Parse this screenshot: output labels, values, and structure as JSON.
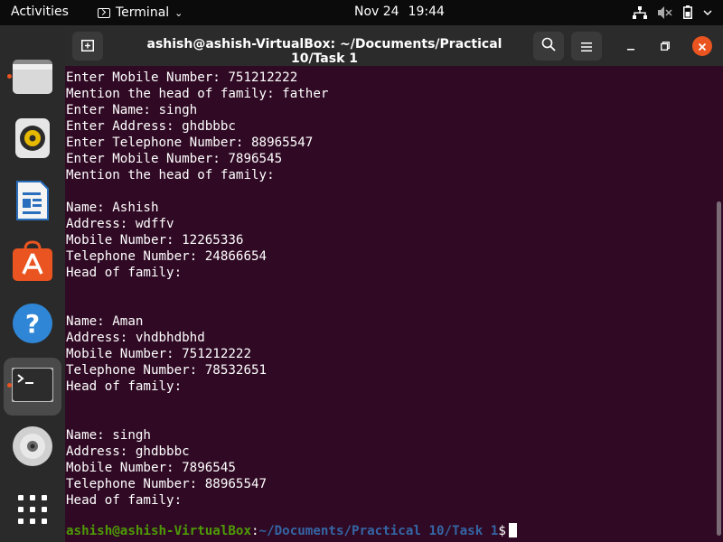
{
  "topbar": {
    "activities": "Activities",
    "app_name": "Terminal",
    "date": "Nov 24",
    "time": "19:44"
  },
  "dock": {
    "items": [
      {
        "name": "files",
        "icon": "folder-icon"
      },
      {
        "name": "rhythmbox",
        "icon": "speaker-icon"
      },
      {
        "name": "writer",
        "icon": "document-icon"
      },
      {
        "name": "software",
        "icon": "shopping-bag-icon"
      },
      {
        "name": "help",
        "icon": "help-icon"
      },
      {
        "name": "terminal",
        "icon": "terminal-icon"
      },
      {
        "name": "disc",
        "icon": "disc-icon"
      },
      {
        "name": "apps",
        "icon": "grid-icon"
      }
    ]
  },
  "terminal": {
    "title": "ashish@ashish-VirtualBox: ~/Documents/Practical 10/Task 1",
    "lines": [
      "Enter Mobile Number: 751212222",
      "Mention the head of family: father",
      "Enter Name: singh",
      "Enter Address: ghdbbbc",
      "Enter Telephone Number: 88965547",
      "Enter Mobile Number: 7896545",
      "Mention the head of family:",
      "",
      "Name: Ashish",
      "Address: wdffv",
      "Mobile Number: 12265336",
      "Telephone Number: 24866654",
      "Head of family:",
      "",
      "",
      "Name: Aman",
      "Address: vhdbhdbhd",
      "Mobile Number: 751212222",
      "Telephone Number: 78532651",
      "Head of family:",
      "",
      "",
      "Name: singh",
      "Address: ghdbbbc",
      "Mobile Number: 7896545",
      "Telephone Number: 88965547",
      "Head of family:"
    ],
    "prompt": {
      "user_host": "ashish@ashish-VirtualBox",
      "colon": ":",
      "path": "~/Documents/Practical 10/Task 1",
      "symbol": "$"
    }
  },
  "colors": {
    "terminal_bg": "#300a24",
    "accent": "#e95420",
    "prompt_user": "#4e9a06",
    "prompt_path": "#3465a4"
  }
}
